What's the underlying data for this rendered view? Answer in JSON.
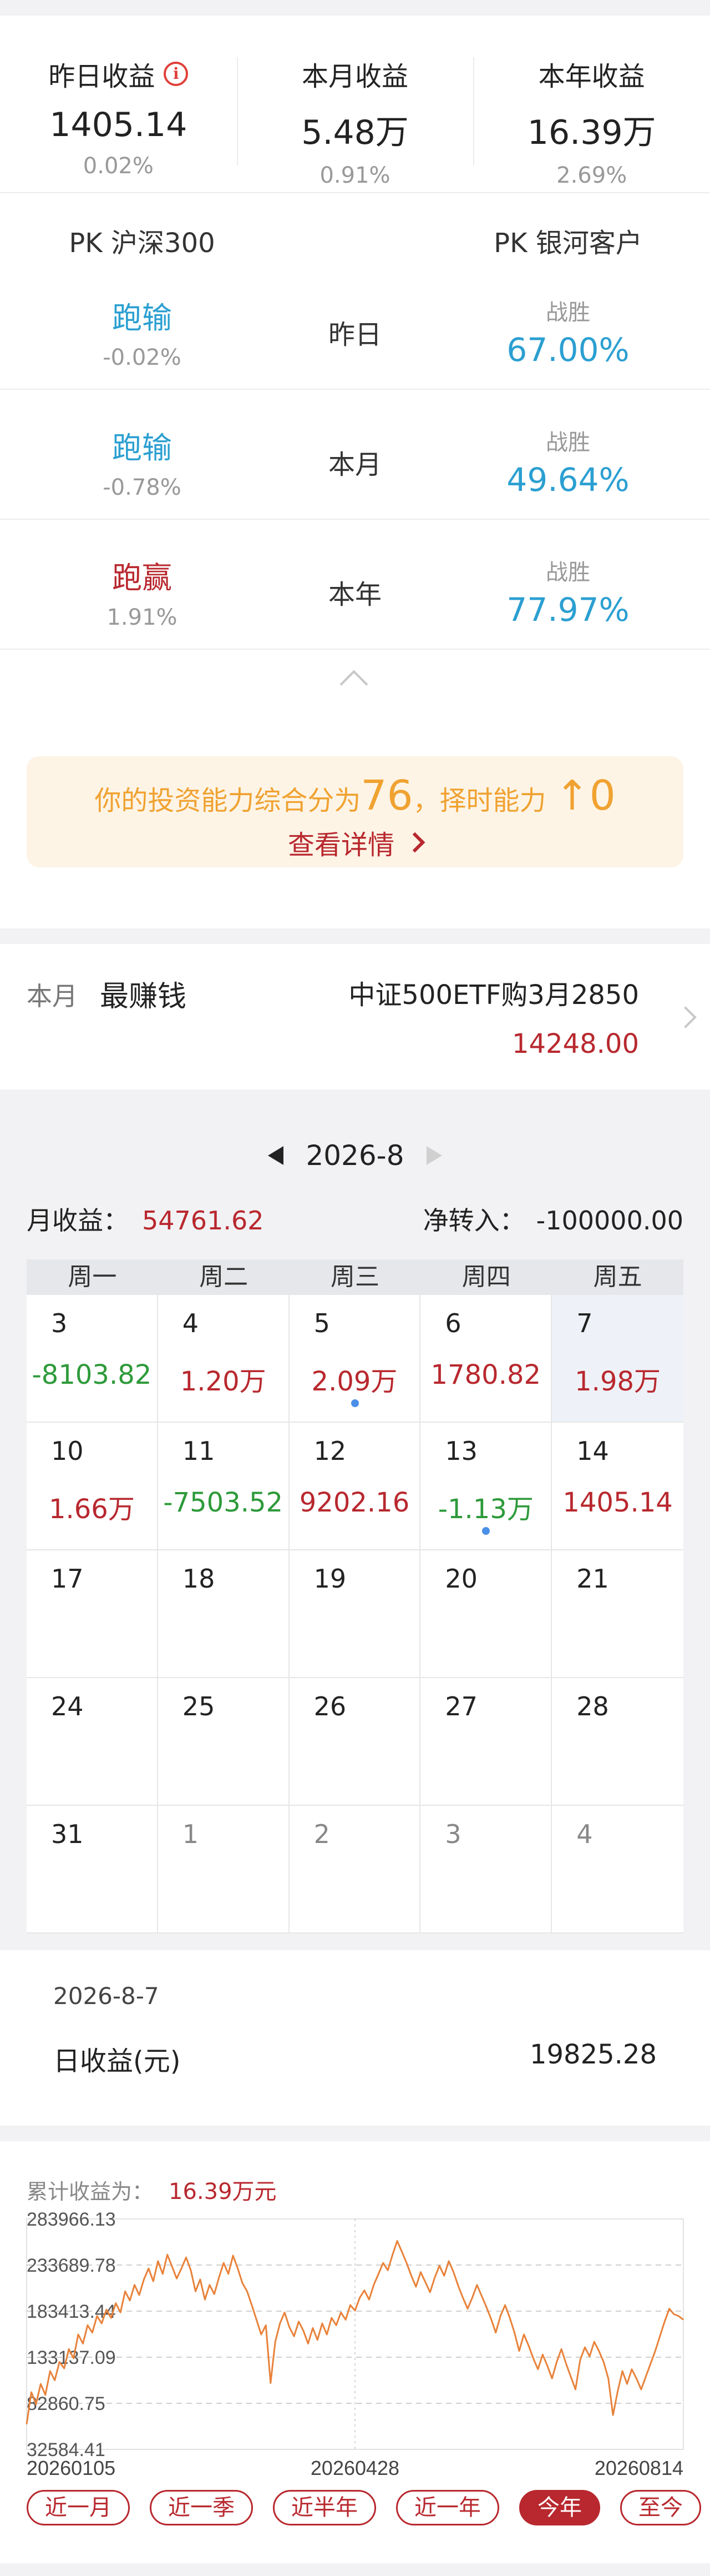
{
  "summary": {
    "items": [
      {
        "title": "昨日收益",
        "value": "1405.14",
        "pct": "0.02%"
      },
      {
        "title": "本月收益",
        "value": "5.48万",
        "pct": "0.91%"
      },
      {
        "title": "本年收益",
        "value": "16.39万",
        "pct": "2.69%"
      }
    ],
    "info_icon_glyph": "i"
  },
  "pk": {
    "left_header": "PK 沪深300",
    "right_header": "PK 银河客户",
    "rows": [
      {
        "result": "跑输",
        "diff": "-0.02%",
        "period": "昨日",
        "win_label": "战胜",
        "win_rate": "67.00%"
      },
      {
        "result": "跑输",
        "diff": "-0.78%",
        "period": "本月",
        "win_label": "战胜",
        "win_rate": "49.64%"
      },
      {
        "result": "跑赢",
        "diff": "1.91%",
        "period": "本年",
        "win_label": "战胜",
        "win_rate": "77.97%"
      }
    ]
  },
  "ability": {
    "prefix": "你的投资能力综合分为",
    "score": "76",
    "middle": "，择时能力",
    "arrow": "↑",
    "timing": "0",
    "link": "查看详情"
  },
  "best": {
    "period": "本月",
    "title": "最赚钱",
    "name": "中证500ETF购3月2850",
    "value": "14248.00"
  },
  "calendar": {
    "month": "2026-8",
    "month_income_label": "月收益：",
    "month_income": "54761.62",
    "net_in_label": "净转入：",
    "net_in": "-100000.00",
    "weekdays": [
      "周一",
      "周二",
      "周三",
      "周四",
      "周五"
    ],
    "cells": [
      {
        "day": "3",
        "value": "-8103.82",
        "sign": "neg"
      },
      {
        "day": "4",
        "value": "1.20万",
        "sign": "pos"
      },
      {
        "day": "5",
        "value": "2.09万",
        "sign": "pos",
        "dot": true
      },
      {
        "day": "6",
        "value": "1780.82",
        "sign": "pos"
      },
      {
        "day": "7",
        "value": "1.98万",
        "sign": "pos",
        "selected": true
      },
      {
        "day": "10",
        "value": "1.66万",
        "sign": "pos"
      },
      {
        "day": "11",
        "value": "-7503.52",
        "sign": "neg"
      },
      {
        "day": "12",
        "value": "9202.16",
        "sign": "pos"
      },
      {
        "day": "13",
        "value": "-1.13万",
        "sign": "neg",
        "dot": true
      },
      {
        "day": "14",
        "value": "1405.14",
        "sign": "pos"
      },
      {
        "day": "17"
      },
      {
        "day": "18"
      },
      {
        "day": "19"
      },
      {
        "day": "20"
      },
      {
        "day": "21"
      },
      {
        "day": "24"
      },
      {
        "day": "25"
      },
      {
        "day": "26"
      },
      {
        "day": "27"
      },
      {
        "day": "28"
      },
      {
        "day": "31"
      },
      {
        "day": "1",
        "other": true
      },
      {
        "day": "2",
        "other": true
      },
      {
        "day": "3",
        "other": true
      },
      {
        "day": "4",
        "other": true
      }
    ]
  },
  "daily": {
    "date": "2026-8-7",
    "label": "日收益(元)",
    "value": "19825.28"
  },
  "cumulative": {
    "title": "累计收益为：",
    "value": "16.39万元",
    "tabs": [
      {
        "label": "近一月",
        "active": false
      },
      {
        "label": "近一季",
        "active": false
      },
      {
        "label": "近半年",
        "active": false
      },
      {
        "label": "近一年",
        "active": false
      },
      {
        "label": "今年",
        "active": true
      },
      {
        "label": "至今",
        "active": false
      }
    ]
  },
  "colors": {
    "brand_red": "#b8282e",
    "lose_blue": "#2b9fd1",
    "loss_green": "#2e9a3a",
    "ability_orange": "#f0a231",
    "chart_line": "#e8823a"
  },
  "chart_data": {
    "type": "line",
    "yticks": [
      "283966.13",
      "233689.78",
      "183413.44",
      "133137.09",
      "82860.75",
      "32584.41"
    ],
    "ylim": [
      32584.41,
      283966.13
    ],
    "xticks": [
      "20260105",
      "20260428",
      "20260814"
    ],
    "series": [
      {
        "values": [
          60000,
          95000,
          82000,
          104000,
          92000,
          118000,
          108000,
          128000,
          121000,
          142000,
          132000,
          158000,
          148000,
          168000,
          160000,
          178000,
          170000,
          185000,
          176000,
          192000,
          182000,
          205000,
          195000,
          212000,
          201000,
          218000,
          230000,
          216000,
          238000,
          224000,
          245000,
          232000,
          219000,
          230000,
          242000,
          228000,
          205000,
          218000,
          196000,
          212000,
          202000,
          220000,
          236000,
          224000,
          244000,
          230000,
          214000,
          205000,
          190000,
          174000,
          158000,
          168000,
          105000,
          150000,
          170000,
          182000,
          166000,
          156000,
          172000,
          162000,
          148000,
          165000,
          152000,
          170000,
          158000,
          176000,
          168000,
          182000,
          174000,
          190000,
          184000,
          198000,
          206000,
          196000,
          212000,
          224000,
          236000,
          228000,
          245000,
          260000,
          248000,
          236000,
          222000,
          210000,
          226000,
          215000,
          204000,
          220000,
          233000,
          222000,
          238000,
          226000,
          211000,
          198000,
          186000,
          198000,
          212000,
          200000,
          188000,
          175000,
          160000,
          178000,
          190000,
          176000,
          160000,
          140000,
          158000,
          146000,
          132000,
          120000,
          136000,
          124000,
          110000,
          128000,
          142000,
          126000,
          112000,
          98000,
          130000,
          144000,
          134000,
          150000,
          140000,
          128000,
          110000,
          70000,
          96000,
          118000,
          104000,
          120000,
          110000,
          98000,
          112000,
          126000,
          140000,
          156000,
          172000,
          186000,
          180000,
          178000,
          174000
        ]
      }
    ]
  }
}
